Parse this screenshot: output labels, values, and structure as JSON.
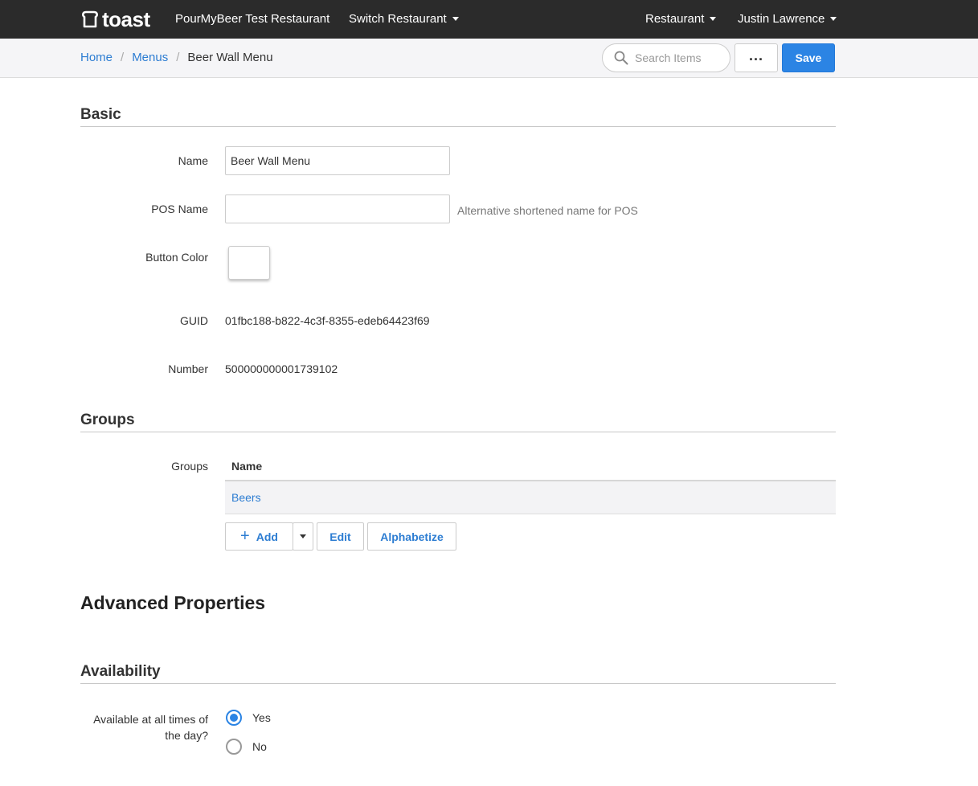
{
  "brand": {
    "logo_text": "toast"
  },
  "nav": {
    "restaurant_name": "PourMyBeer Test Restaurant",
    "switch_restaurant": "Switch Restaurant",
    "restaurant_menu": "Restaurant",
    "user_name": "Justin Lawrence"
  },
  "breadcrumb": {
    "home": "Home",
    "menus": "Menus",
    "current": "Beer Wall Menu",
    "separator": "/"
  },
  "toolbar": {
    "search_placeholder": "Search Items",
    "more_label": "...",
    "save_label": "Save"
  },
  "basic": {
    "title": "Basic",
    "name_label": "Name",
    "name_value": "Beer Wall Menu",
    "pos_name_label": "POS Name",
    "pos_name_value": "",
    "pos_name_hint": "Alternative shortened name for POS",
    "button_color_label": "Button Color",
    "button_color_value": "#ffffff",
    "guid_label": "GUID",
    "guid_value": "01fbc188-b822-4c3f-8355-edeb64423f69",
    "number_label": "Number",
    "number_value": "500000000001739102"
  },
  "groups": {
    "title": "Groups",
    "label": "Groups",
    "column_name": "Name",
    "rows": [
      {
        "name": "Beers"
      }
    ],
    "add_label": "Add",
    "edit_label": "Edit",
    "alphabetize_label": "Alphabetize"
  },
  "advanced": {
    "title": "Advanced Properties"
  },
  "availability": {
    "title": "Availability",
    "question_line1": "Available at all times of",
    "question_line2": "the day?",
    "options": [
      {
        "label": "Yes",
        "selected": true
      },
      {
        "label": "No",
        "selected": false
      }
    ]
  },
  "colors": {
    "accent": "#2b84e4",
    "link": "#2d7dd2",
    "topbar": "#2b2b2b"
  }
}
